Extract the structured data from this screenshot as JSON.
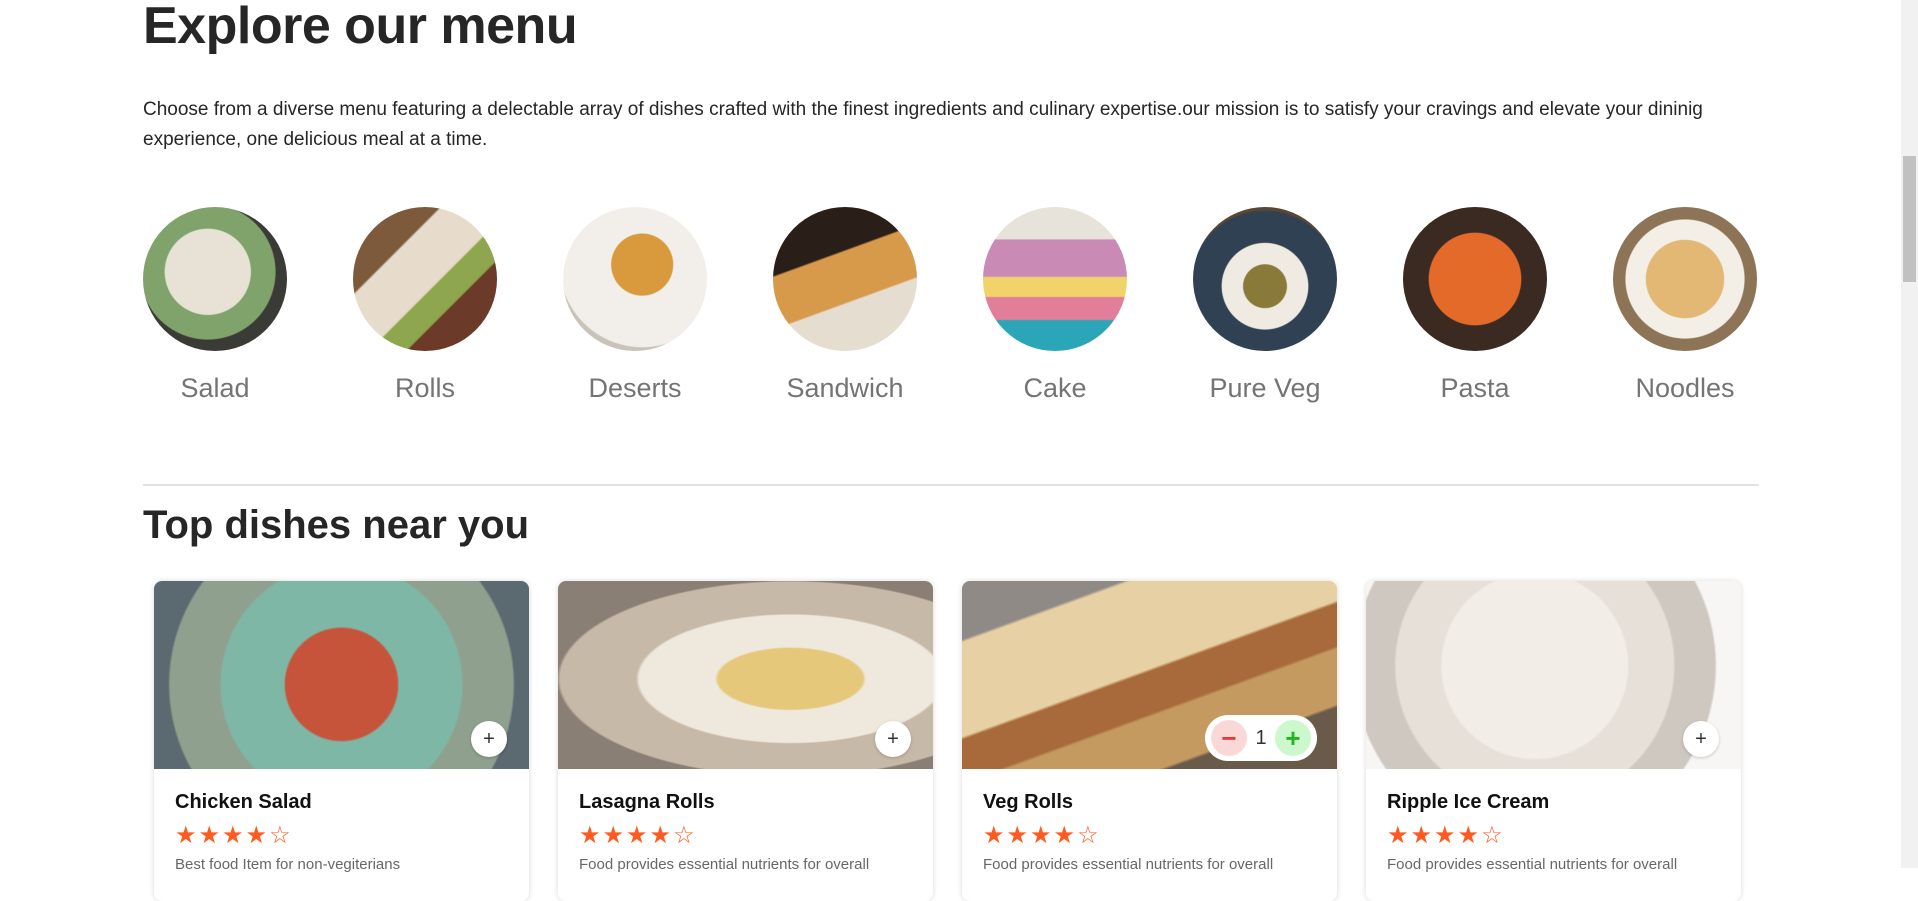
{
  "explore": {
    "title": "Explore our menu",
    "description": "Choose from a diverse menu featuring a delectable array of dishes crafted with the finest ingredients and culinary expertise.our mission is to satisfy your cravings and elevate your dininig experience, one delicious meal at a time."
  },
  "menu": [
    {
      "label": "Salad",
      "color": "#8fa27a"
    },
    {
      "label": "Rolls",
      "color": "#b9804e"
    },
    {
      "label": "Deserts",
      "color": "#d9cfc2"
    },
    {
      "label": "Sandwich",
      "color": "#4a3a2a"
    },
    {
      "label": "Cake",
      "color": "#6fb0c0"
    },
    {
      "label": "Pure Veg",
      "color": "#3c4f5e"
    },
    {
      "label": "Pasta",
      "color": "#7a3f22"
    },
    {
      "label": "Noodles",
      "color": "#a08a70"
    }
  ],
  "top_dishes": {
    "title": "Top dishes near you",
    "items": [
      {
        "name": "Chicken Salad",
        "rating": 4,
        "description": "Best food Item for non-vegiterians",
        "add_symbol": "+",
        "color": "#7aa890"
      },
      {
        "name": "Lasagna Rolls",
        "rating": 4,
        "description": "Food provides essential nutrients for overall",
        "add_symbol": "+",
        "color": "#d7c9b0"
      },
      {
        "name": "Veg Rolls",
        "rating": 4,
        "description": "Food provides essential nutrients for overall",
        "count": "1",
        "minus_symbol": "−",
        "plus_symbol": "+",
        "color": "#c9a56a"
      },
      {
        "name": "Ripple Ice Cream",
        "rating": 4,
        "description": "Food provides essential nutrients for overall",
        "add_symbol": "+",
        "color": "#ece6df"
      }
    ]
  },
  "icons": {
    "star_filled": "★",
    "star_empty": "☆"
  }
}
